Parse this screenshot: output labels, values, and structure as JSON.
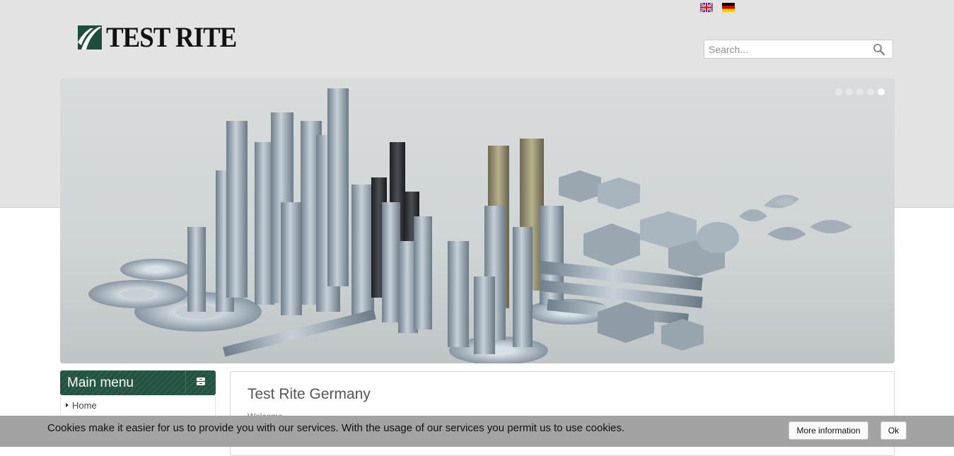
{
  "header": {
    "logo_text": "TEST RITE",
    "languages": [
      "English",
      "Deutsch"
    ]
  },
  "search": {
    "placeholder": "Search...",
    "value": ""
  },
  "slider": {
    "slide_count": 5,
    "active_index": 4
  },
  "sidebar": {
    "title": "Main menu",
    "items": [
      {
        "label": "Home"
      }
    ]
  },
  "main": {
    "title": "Test Rite Germany",
    "subtitle": "Welcome"
  },
  "cookie": {
    "text": "Cookies make it easier for us to provide you with our services. With the usage of our services you permit us to use cookies.",
    "more_label": "More information",
    "ok_label": "Ok"
  },
  "colors": {
    "brand_green": "#24513f",
    "header_bg": "#e3e3e3",
    "cookie_bg": "#a3a3a3"
  }
}
